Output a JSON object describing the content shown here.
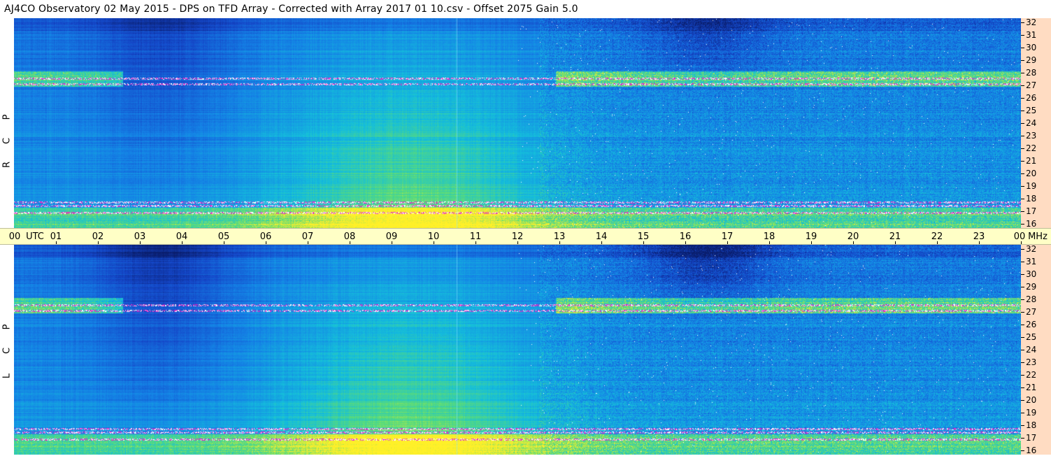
{
  "title": "AJ4CO Observatory  02 May 2015  -  DPS on TFD Array  -  Corrected with Array 2017 01 10.csv  -  Offset 2075  Gain 5.0",
  "panels": [
    {
      "id": "rcp",
      "letters": [
        "R",
        "C",
        "P"
      ]
    },
    {
      "id": "lcp",
      "letters": [
        "L",
        "C",
        "P"
      ]
    }
  ],
  "time_axis": {
    "first_label": "00",
    "utc_label": "UTC",
    "unit_label": "MHz",
    "hours": [
      "01",
      "02",
      "03",
      "04",
      "05",
      "06",
      "07",
      "08",
      "09",
      "10",
      "11",
      "12",
      "13",
      "14",
      "15",
      "16",
      "17",
      "18",
      "19",
      "20",
      "21",
      "22",
      "23",
      "00"
    ]
  },
  "colors": {
    "time_axis_bg": "#ffffc6",
    "freq_scale_bg": "#ffdcc2"
  },
  "chart_data": {
    "type": "heatmap",
    "title": "AJ4CO Observatory  02 May 2015  -  DPS on TFD Array  -  Corrected with Array 2017 01 10.csv  -  Offset 2075  Gain 5.0",
    "xlabel": "UTC",
    "ylabel": "MHz",
    "xlim": [
      0,
      24
    ],
    "ylim": [
      16,
      32
    ],
    "x_ticks": [
      "00",
      "01",
      "02",
      "03",
      "04",
      "05",
      "06",
      "07",
      "08",
      "09",
      "10",
      "11",
      "12",
      "13",
      "14",
      "15",
      "16",
      "17",
      "18",
      "19",
      "20",
      "21",
      "22",
      "23",
      "00"
    ],
    "y_ticks": [
      16,
      17,
      18,
      19,
      20,
      21,
      22,
      23,
      24,
      25,
      26,
      27,
      28,
      29,
      30,
      31,
      32
    ],
    "series": [
      {
        "name": "RCP"
      },
      {
        "name": "LCP"
      }
    ],
    "interference_bands_mhz": [
      17.2,
      17.7,
      18.0,
      27.0,
      27.4
    ],
    "grid": false
  }
}
